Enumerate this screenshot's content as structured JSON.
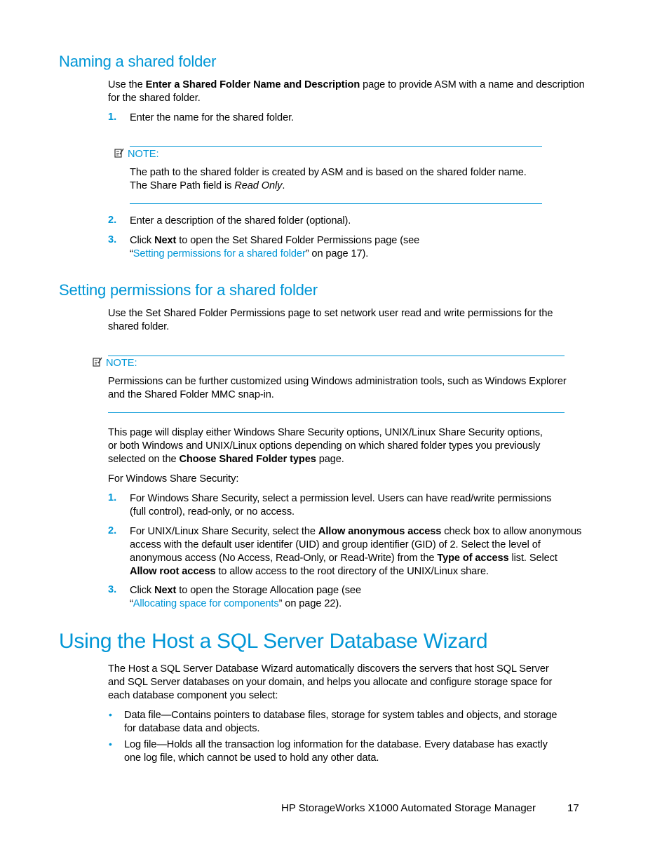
{
  "section1": {
    "heading": "Naming a shared folder",
    "intro_pre": "Use the ",
    "intro_bold": "Enter a Shared Folder Name and Description",
    "intro_post": " page to provide ASM with a name and description",
    "intro_line2": "for the shared folder.",
    "step1_num": "1.",
    "step1": "Enter the name for the shared folder.",
    "note_label": "NOTE:",
    "note_line1": "The path to the shared folder is created by ASM and is based on the shared folder name.",
    "note_line2_pre": "The Share Path field is ",
    "note_line2_italic": "Read Only",
    "note_line2_post": ".",
    "step2_num": "2.",
    "step2": "Enter a description of the shared folder (optional).",
    "step3_num": "3.",
    "step3_pre": "Click ",
    "step3_bold": "Next",
    "step3_post": " to open the Set Shared Folder Permissions page (see",
    "step3_quote_open": "“",
    "step3_link": "Setting permissions for a shared folder",
    "step3_tail": "” on page 17)."
  },
  "section2": {
    "heading": "Setting permissions for a shared folder",
    "intro_line1": "Use the Set Shared Folder Permissions page to set network user read and write permissions for the",
    "intro_line2": "shared folder.",
    "note_label": "NOTE:",
    "note_line1": "Permissions can be further customized using Windows administration tools, such as Windows Explorer",
    "note_line2": "and the Shared Folder MMC snap-in.",
    "para_line1": "This page will display either Windows Share Security options, UNIX/Linux Share Security options,",
    "para_line2": "or both Windows and UNIX/Linux options depending on which shared folder types you previously",
    "para_line3_pre": "selected on the ",
    "para_line3_bold": "Choose Shared Folder types",
    "para_line3_post": " page.",
    "for_windows": "For Windows Share Security:",
    "step1_num": "1.",
    "step1_line1": "For Windows Share Security, select a permission level. Users can have read/write permissions",
    "step1_line2": "(full control), read-only, or no access.",
    "step2_num": "2.",
    "step2_l1_pre": "For UNIX/Linux Share Security, select the ",
    "step2_l1_bold": "Allow anonymous access",
    "step2_l1_post": " check box to allow anonymous",
    "step2_l2": "access with the default user identifer (UID) and group identifier (GID) of 2. Select the level of",
    "step2_l3_pre": "anonymous access (No Access, Read-Only, or Read-Write) from the ",
    "step2_l3_bold": "Type of access",
    "step2_l3_post": " list. Select",
    "step2_l4_bold": "Allow root access",
    "step2_l4_post": " to allow access to the root directory of the UNIX/Linux share.",
    "step3_num": "3.",
    "step3_pre": "Click ",
    "step3_bold": "Next",
    "step3_post": " to open the Storage Allocation page (see",
    "step3_quote_open": "“",
    "step3_link": "Allocating space for components",
    "step3_tail": "” on page 22)."
  },
  "section3": {
    "heading": "Using the Host a SQL Server Database Wizard",
    "intro_line1": "The Host a SQL Server Database Wizard automatically discovers the servers that host SQL Server",
    "intro_line2": "and SQL Server databases on your domain, and helps you allocate and configure storage space for",
    "intro_line3": "each database component you select:",
    "bullets": [
      {
        "line1": "Data file—Contains pointers to database files, storage for system tables and objects, and storage",
        "line2": "for database data and objects."
      },
      {
        "line1": "Log file—Holds all the transaction log information for the database. Every database has exactly",
        "line2": "one log file, which cannot be used to hold any other data."
      }
    ],
    "bullet_glyph": "•"
  },
  "footer": {
    "title": "HP StorageWorks X1000 Automated Storage Manager",
    "page_number": "17"
  },
  "colors": {
    "accent": "#0096d6",
    "text": "#000000"
  }
}
